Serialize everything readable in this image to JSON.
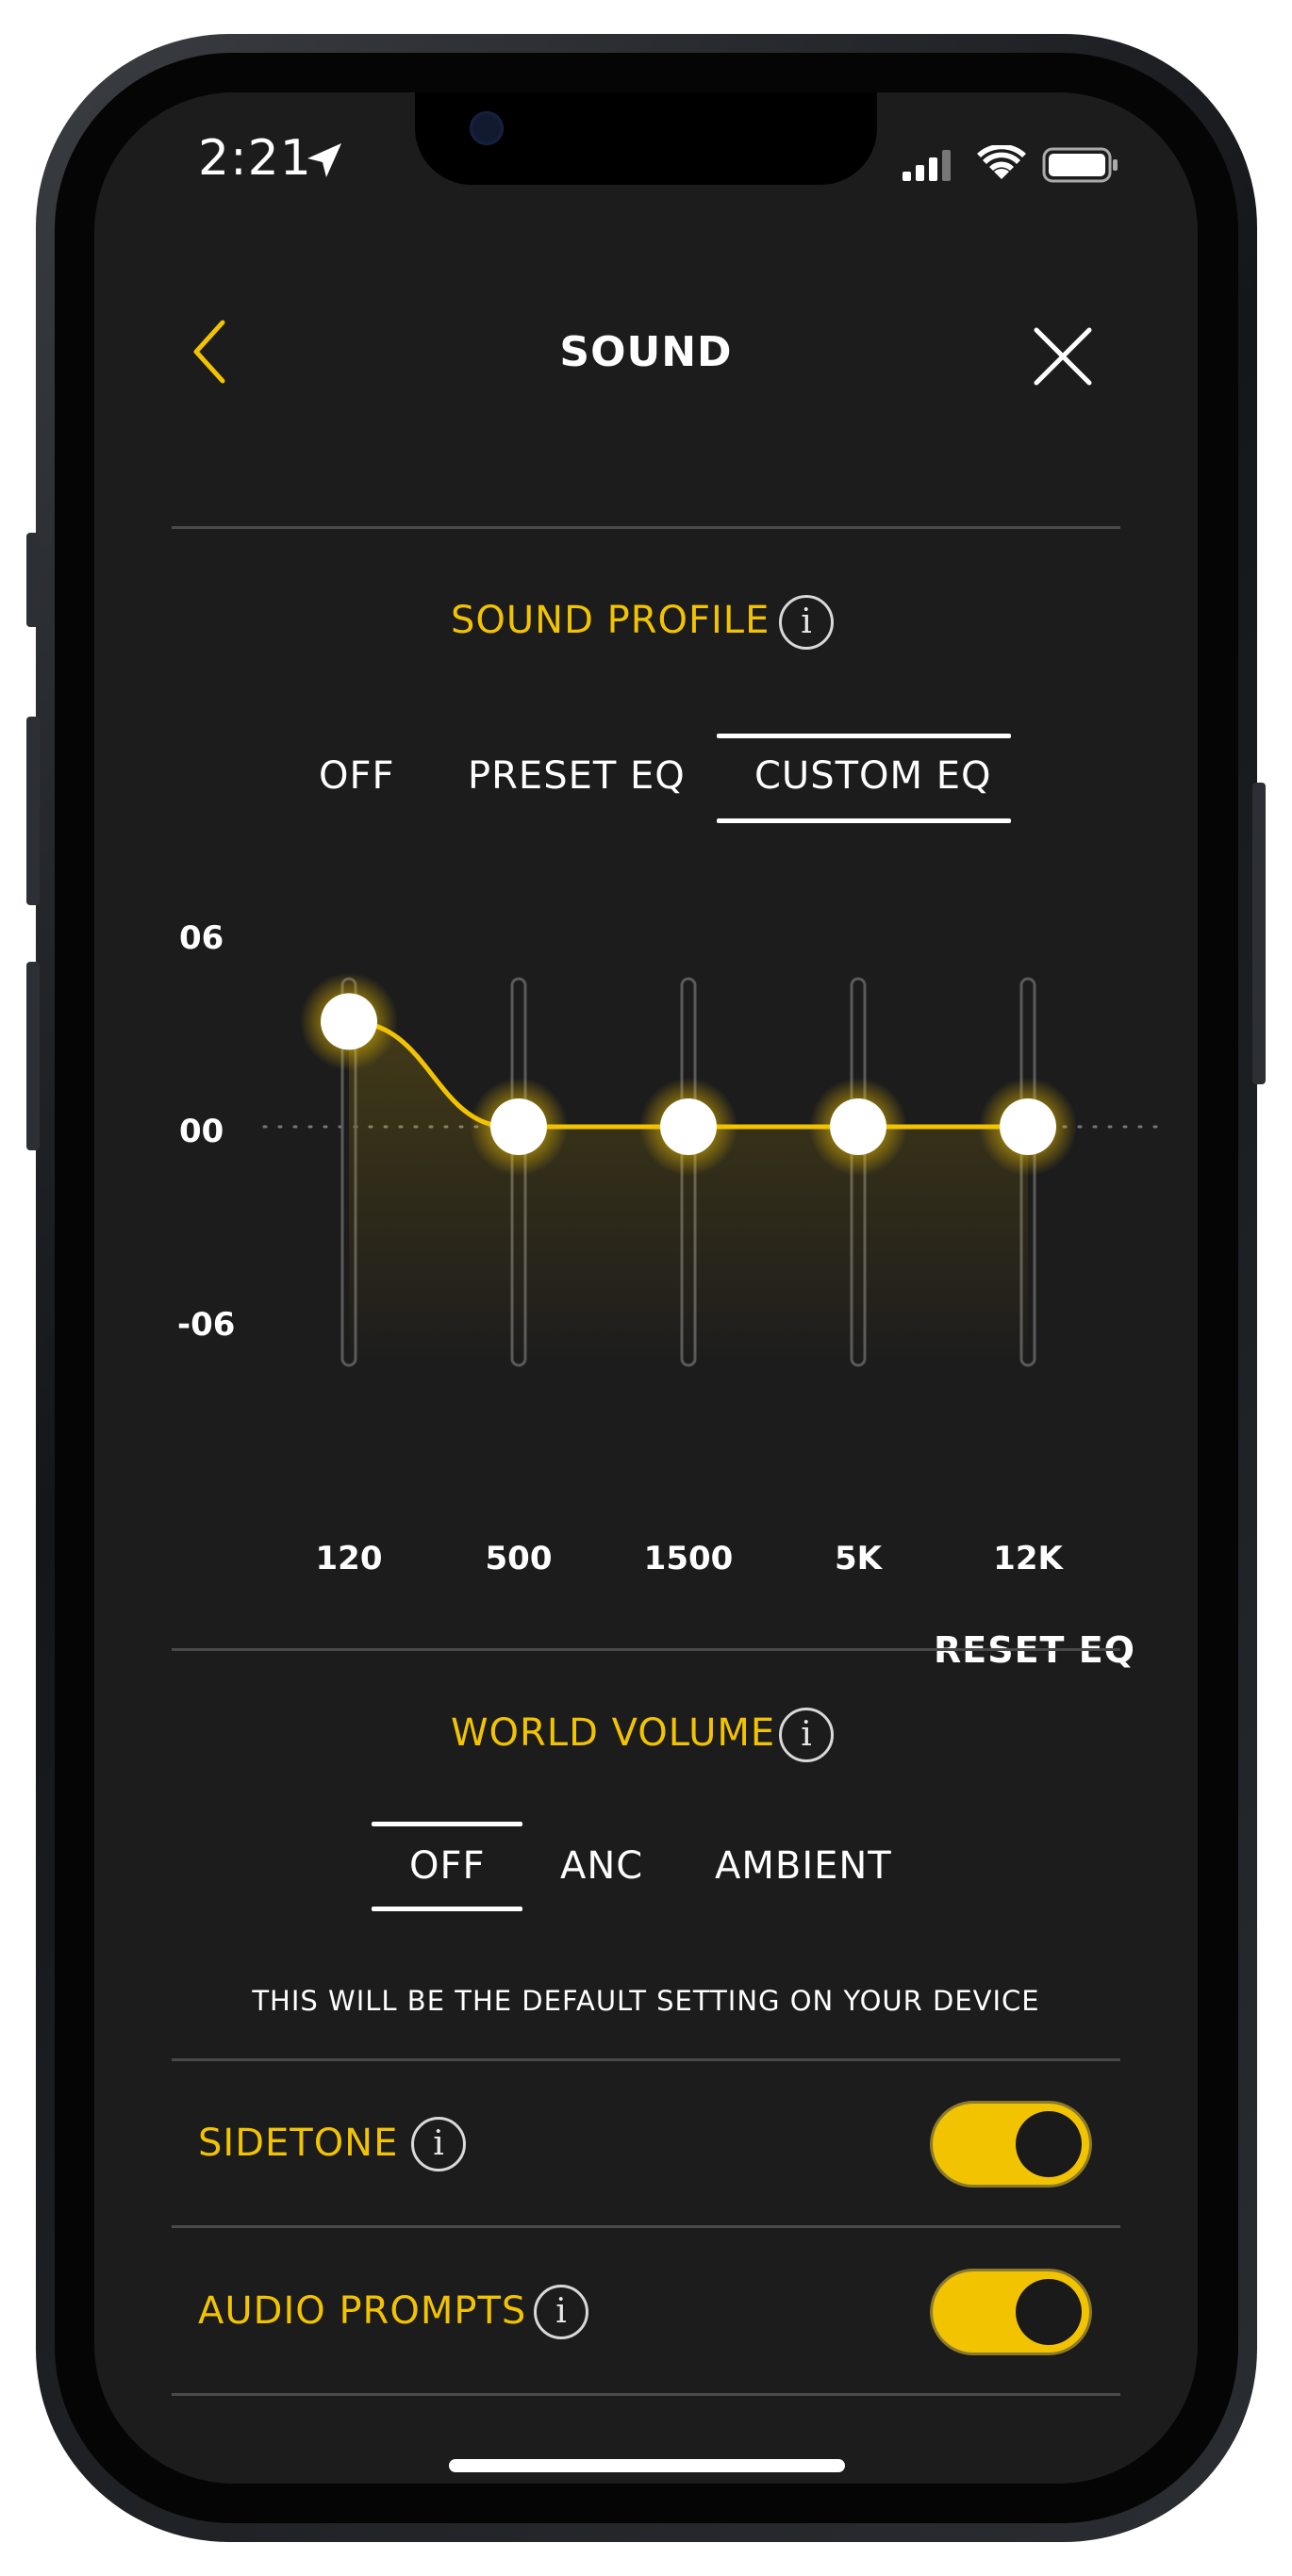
{
  "status_bar": {
    "time": "2:21"
  },
  "header": {
    "title": "SOUND",
    "back_icon": "chevron-left-icon",
    "close_icon": "close-icon"
  },
  "sound_profile": {
    "label": "SOUND PROFILE",
    "tabs": [
      {
        "label": "OFF",
        "selected": false
      },
      {
        "label": "PRESET EQ",
        "selected": false
      },
      {
        "label": "CUSTOM EQ",
        "selected": true
      }
    ]
  },
  "equalizer": {
    "y_ticks": [
      "06",
      "00",
      "-06"
    ],
    "bands": [
      {
        "label": "120",
        "gain": 3.3
      },
      {
        "label": "500",
        "gain": 0
      },
      {
        "label": "1500",
        "gain": 0
      },
      {
        "label": "5K",
        "gain": 0
      },
      {
        "label": "12K",
        "gain": 0
      }
    ],
    "range": [
      -6,
      6
    ],
    "reset_label": "RESET EQ"
  },
  "world_volume": {
    "label": "WORLD VOLUME",
    "tabs": [
      {
        "label": "OFF",
        "selected": true
      },
      {
        "label": "ANC",
        "selected": false
      },
      {
        "label": "AMBIENT",
        "selected": false
      }
    ],
    "note": "THIS WILL BE THE DEFAULT SETTING ON YOUR DEVICE"
  },
  "settings": [
    {
      "label": "SIDETONE",
      "on": true
    },
    {
      "label": "AUDIO PROMPTS",
      "on": true
    }
  ],
  "colors": {
    "accent": "#f2c301",
    "background": "#1c1c1c",
    "text": "#ffffff",
    "divider": "#4a4a4a"
  }
}
